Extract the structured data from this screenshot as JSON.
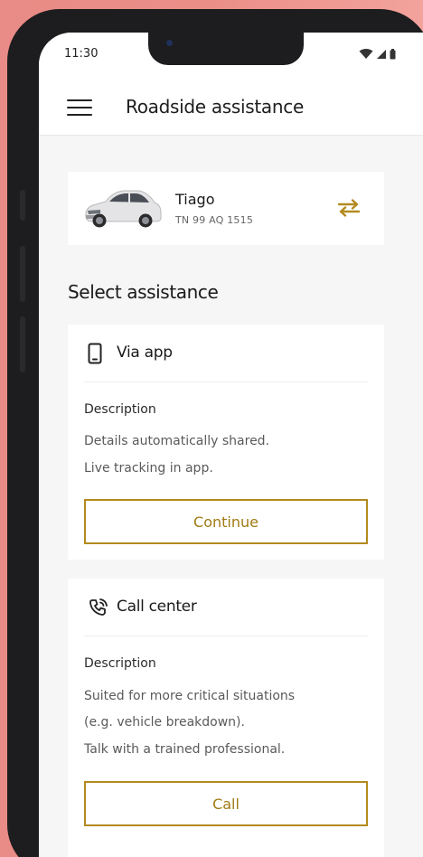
{
  "status_bar": {
    "time": "11:30"
  },
  "app_bar": {
    "title": "Roadside assistance"
  },
  "vehicle": {
    "name": "Tiago",
    "plate": "TN 99 AQ 1515"
  },
  "section": {
    "title": "Select assistance"
  },
  "options": [
    {
      "title": "Via app",
      "icon": "smartphone-icon",
      "description_label": "Description",
      "description_lines": [
        "Details automatically shared.",
        "Live tracking in app."
      ],
      "button_label": "Continue"
    },
    {
      "title": "Call center",
      "icon": "phone-call-icon",
      "description_label": "Description",
      "description_lines": [
        "Suited for more critical situations",
        "(e.g. vehicle breakdown).",
        "Talk with a trained professional."
      ],
      "button_label": "Call"
    }
  ],
  "colors": {
    "accent": "#b38a1f",
    "background": "#f6f6f6",
    "outer_background": "#ec8e88"
  }
}
